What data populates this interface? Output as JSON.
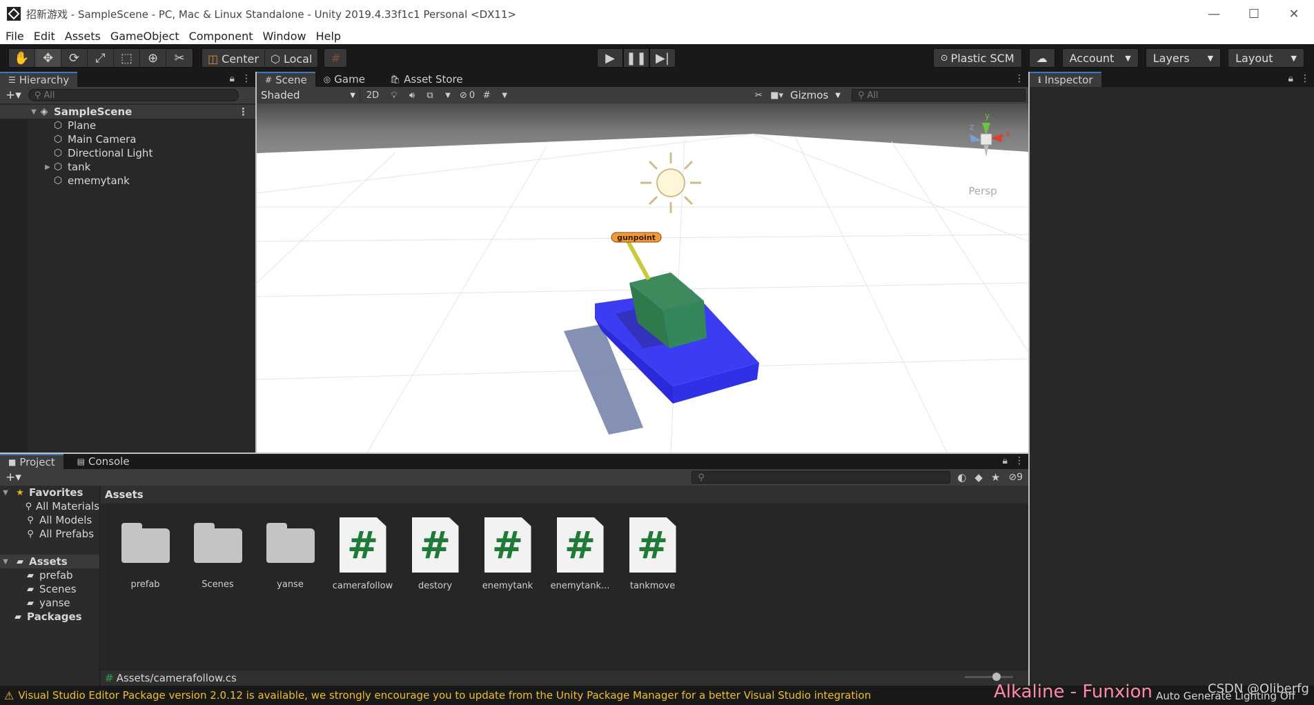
{
  "window": {
    "title": "招新游戏 - SampleScene - PC, Mac & Linux Standalone - Unity 2019.4.33f1c1 Personal <DX11>",
    "minimize": "—",
    "maximize": "☐",
    "close": "✕"
  },
  "menu": [
    "File",
    "Edit",
    "Assets",
    "GameObject",
    "Component",
    "Window",
    "Help"
  ],
  "toolbar": {
    "pivot": "Center",
    "space": "Local",
    "plastic": "Plastic SCM",
    "account": "Account",
    "layers": "Layers",
    "layout": "Layout"
  },
  "hierarchy": {
    "tab": "Hierarchy",
    "search_placeholder": "All",
    "scene": "SampleScene",
    "items": [
      "Plane",
      "Main Camera",
      "Directional Light",
      "tank",
      "ememytank"
    ]
  },
  "scene_view": {
    "tabs": [
      "Scene",
      "Game",
      "Asset Store"
    ],
    "shading": "Shaded",
    "mode_2d": "2D",
    "hidden_count": "0",
    "gizmos": "Gizmos",
    "search_placeholder": "All",
    "persp": "Persp",
    "gunpoint_label": "gunpoint",
    "axis_x": "x",
    "axis_y": "y",
    "axis_z": "z"
  },
  "inspector": {
    "tab": "Inspector"
  },
  "project": {
    "tabs": [
      "Project",
      "Console"
    ],
    "hidden_count": "9",
    "favorites": {
      "label": "Favorites",
      "items": [
        "All Materials",
        "All Models",
        "All Prefabs"
      ]
    },
    "assets_tree": {
      "label": "Assets",
      "items": [
        "prefab",
        "Scenes",
        "yanse"
      ]
    },
    "packages": "Packages",
    "assets_header": "Assets",
    "assets": [
      {
        "name": "prefab",
        "type": "folder"
      },
      {
        "name": "Scenes",
        "type": "folder"
      },
      {
        "name": "yanse",
        "type": "folder"
      },
      {
        "name": "camerafollow",
        "type": "script"
      },
      {
        "name": "destory",
        "type": "script"
      },
      {
        "name": "enemytank",
        "type": "script"
      },
      {
        "name": "enemytank...",
        "type": "script"
      },
      {
        "name": "tankmove",
        "type": "script"
      }
    ],
    "script_glyph": "#",
    "selected_path": "Assets/camerafollow.cs"
  },
  "status": {
    "message": "Visual Studio Editor Package version 2.0.12 is available, we strongly encourage you to update from the Unity Package Manager for a better Visual Studio integration",
    "overlay": "Alkaline - Funxion",
    "auto_lighting": "Auto Generate Lighting Off",
    "watermark": "CSDN @Oliberfg"
  }
}
